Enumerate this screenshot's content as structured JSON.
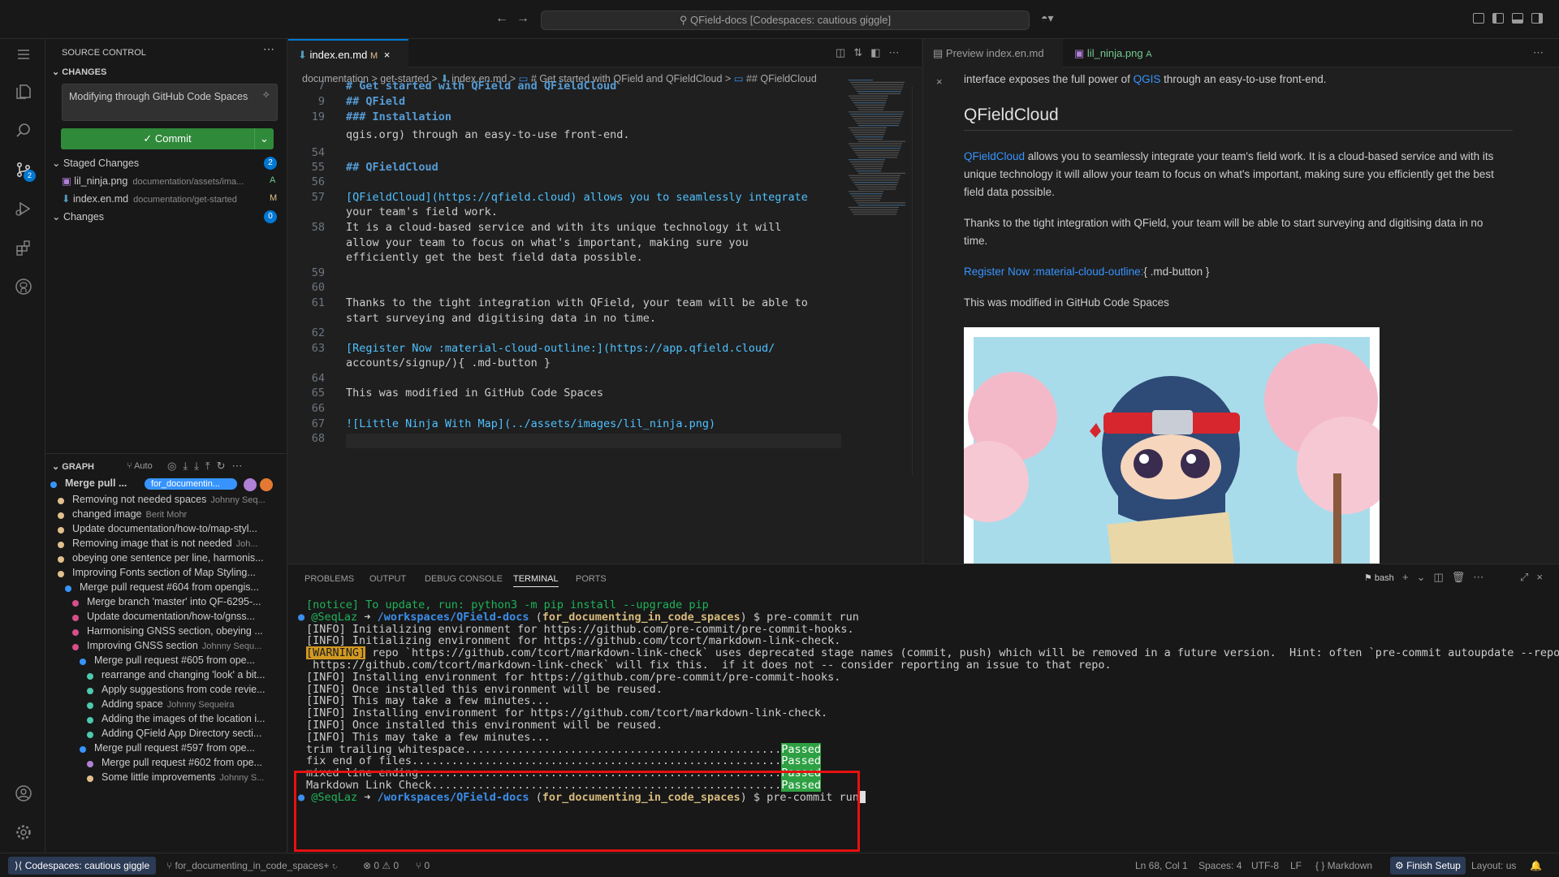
{
  "titlebar": {
    "search": "QField-docs [Codespaces: cautious giggle]"
  },
  "activity": {
    "scm_badge": "2"
  },
  "sidebar": {
    "title": "SOURCE CONTROL",
    "changes_header": "CHANGES",
    "commit_message": "Modifying through GitHub Code Spaces",
    "commit_label": "✓ Commit",
    "staged_label": "Staged Changes",
    "staged_count": "2",
    "staged": [
      {
        "name": "lil_ninja.png",
        "path": "documentation/assets/ima...",
        "status": "A"
      },
      {
        "name": "index.en.md",
        "path": "documentation/get-started",
        "status": "M"
      }
    ],
    "changes_label": "Changes",
    "changes_count": "0",
    "graph_title": "GRAPH",
    "graph_auto": "Auto",
    "graph_branch": "for_documentin...",
    "graph": [
      {
        "msg": "Merge pull ...",
        "author": "",
        "color": "#3794ff"
      },
      {
        "msg": "Removing not needed spaces",
        "author": "Johnny Seq...",
        "color": "#e2c08d"
      },
      {
        "msg": "changed image",
        "author": "Berit Mohr",
        "color": "#e2c08d"
      },
      {
        "msg": "Update documentation/how-to/map-styl...",
        "author": "",
        "color": "#e2c08d"
      },
      {
        "msg": "Removing image that is not needed",
        "author": "Joh...",
        "color": "#e2c08d"
      },
      {
        "msg": "obeying one sentence per line, harmonis...",
        "author": "",
        "color": "#e2c08d"
      },
      {
        "msg": "Improving Fonts section of Map Styling...",
        "author": "",
        "color": "#e2c08d"
      },
      {
        "msg": "Merge pull request #604 from opengis...",
        "author": "",
        "color": "#3794ff"
      },
      {
        "msg": "Merge branch 'master' into QF-6295-...",
        "author": "",
        "color": "#d64f8b"
      },
      {
        "msg": "Update documentation/how-to/gnss...",
        "author": "",
        "color": "#d64f8b"
      },
      {
        "msg": "Harmonising GNSS section, obeying ...",
        "author": "",
        "color": "#d64f8b"
      },
      {
        "msg": "Improving GNSS section",
        "author": "Johnny Sequ...",
        "color": "#d64f8b"
      },
      {
        "msg": "Merge pull request #605 from ope...",
        "author": "",
        "color": "#3794ff"
      },
      {
        "msg": "rearrange and changing 'look' a bit...",
        "author": "",
        "color": "#4ec9b0"
      },
      {
        "msg": "Apply suggestions from code revie...",
        "author": "",
        "color": "#4ec9b0"
      },
      {
        "msg": "Adding space",
        "author": "Johnny Sequeira",
        "color": "#4ec9b0"
      },
      {
        "msg": "Adding the images of the location i...",
        "author": "",
        "color": "#4ec9b0"
      },
      {
        "msg": "Adding QField App Directory secti...",
        "author": "",
        "color": "#4ec9b0"
      },
      {
        "msg": "Merge pull request #597 from ope...",
        "author": "",
        "color": "#3794ff"
      },
      {
        "msg": "Merge pull request #602 from ope...",
        "author": "",
        "color": "#b180d7"
      },
      {
        "msg": "Some little improvements",
        "author": "Johnny S...",
        "color": "#e2c08d"
      }
    ]
  },
  "editor": {
    "tab": "index.en.md",
    "tab_status": "M",
    "breadcrumb": [
      "documentation",
      "get-started",
      "index.en.md",
      "# Get started with QField and QFieldCloud",
      "## QFieldCloud"
    ],
    "sticky": [
      {
        "ln": "7",
        "text": "# Get started with QField and QFieldCloud"
      },
      {
        "ln": "9",
        "text": "## QField"
      },
      {
        "ln": "19",
        "text": "### Installation"
      }
    ],
    "lines": [
      {
        "ln": "",
        "text": "qgis.org) through an easy-to-use front-end."
      },
      {
        "ln": "54",
        "text": ""
      },
      {
        "ln": "55",
        "text": "## QFieldCloud"
      },
      {
        "ln": "56",
        "text": ""
      },
      {
        "ln": "57",
        "text": "[QFieldCloud](https://qfield.cloud) allows you to seamlessly integrate"
      },
      {
        "ln": "",
        "text": "your team's field work."
      },
      {
        "ln": "58",
        "text": "It is a cloud-based service and with its unique technology it will"
      },
      {
        "ln": "",
        "text": "allow your team to focus on what's important, making sure you"
      },
      {
        "ln": "",
        "text": "efficiently get the best field data possible."
      },
      {
        "ln": "59",
        "text": ""
      },
      {
        "ln": "60",
        "text": ""
      },
      {
        "ln": "61",
        "text": "Thanks to the tight integration with QField, your team will be able to"
      },
      {
        "ln": "",
        "text": "start surveying and digitising data in no time."
      },
      {
        "ln": "62",
        "text": ""
      },
      {
        "ln": "63",
        "text": "[Register Now :material-cloud-outline:](https://app.qfield.cloud/"
      },
      {
        "ln": "",
        "text": "accounts/signup/){ .md-button }"
      },
      {
        "ln": "64",
        "text": ""
      },
      {
        "ln": "65",
        "text": "This was modified in GitHub Code Spaces"
      },
      {
        "ln": "66",
        "text": ""
      },
      {
        "ln": "67",
        "text": "![Little Ninja With Map](../assets/images/lil_ninja.png)"
      },
      {
        "ln": "68",
        "text": ""
      }
    ]
  },
  "preview": {
    "tab1": "Preview index.en.md",
    "tab2": "lil_ninja.png",
    "tab2_status": "A",
    "top_text_a": "interface exposes the full power of ",
    "top_link": "QGIS",
    "top_text_b": " through an easy-to-use front-end.",
    "heading": "QFieldCloud",
    "p1_link": "QFieldCloud",
    "p1": " allows you to seamlessly integrate your team's field work. It is a cloud-based service and with its unique technology it will allow your team to focus on what's important, making sure you efficiently get the best field data possible.",
    "p2": "Thanks to the tight integration with QField, your team will be able to start surveying and digitising data in no time.",
    "p3_link": "Register Now :material-cloud-outline:",
    "p3_rest": "{ .md-button }",
    "p4": "This was modified in GitHub Code Spaces"
  },
  "panel": {
    "tabs": [
      "PROBLEMS",
      "OUTPUT",
      "DEBUG CONSOLE",
      "TERMINAL",
      "PORTS"
    ],
    "shell": "bash",
    "notice": "[notice] To update, run: python3 -m pip install --upgrade pip",
    "prompt_user": "@SeqLaz",
    "prompt_path": "/workspaces/QField-docs",
    "prompt_branch": "for_documenting_in_code_spaces",
    "prompt_cmd": "$ pre-commit run",
    "output": [
      "[INFO] Initializing environment for https://github.com/pre-commit/pre-commit-hooks.",
      "[INFO] Initializing environment for https://github.com/tcort/markdown-link-check."
    ],
    "warning_tag": "[WARNING]",
    "warning": " repo `https://github.com/tcort/markdown-link-check` uses deprecated stage names (commit, push) which will be removed in a future version.  Hint: often `pre-commit autoupdate --repo",
    "warning2": " https://github.com/tcort/markdown-link-check` will fix this.  if it does not -- consider reporting an issue to that repo.",
    "output2": [
      "[INFO] Installing environment for https://github.com/pre-commit/pre-commit-hooks.",
      "[INFO] Once installed this environment will be reused.",
      "[INFO] This may take a few minutes...",
      "[INFO] Installing environment for https://github.com/tcort/markdown-link-check.",
      "[INFO] Once installed this environment will be reused.",
      "[INFO] This may take a few minutes..."
    ],
    "checks": [
      {
        "name": "trim trailing whitespace................................................",
        "result": "Passed"
      },
      {
        "name": "fix end of files........................................................",
        "result": "Passed"
      },
      {
        "name": "mixed line ending.......................................................",
        "result": "Passed"
      },
      {
        "name": "Markdown Link Check.....................................................",
        "result": "Passed"
      }
    ]
  },
  "status": {
    "remote": "Codespaces: cautious giggle",
    "branch": "for_documenting_in_code_spaces+",
    "problems": "⊗ 0 ⚠ 0",
    "ports": "⑂ 0",
    "position": "Ln 68, Col 1",
    "spaces": "Spaces: 4",
    "encoding": "UTF-8",
    "eol": "LF",
    "language": "{ } Markdown",
    "finish": "Finish Setup",
    "layout": "Layout: us"
  }
}
